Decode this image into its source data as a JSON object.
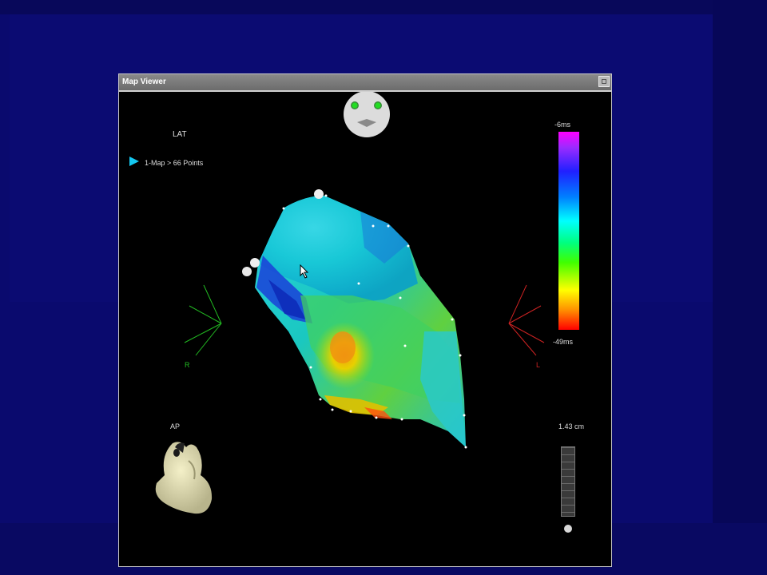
{
  "window": {
    "title": "Map Viewer"
  },
  "map": {
    "mode_label": "LAT",
    "map_entry": "1-Map > 66 Points",
    "view_label": "AP",
    "orientation_right": "R",
    "orientation_left": "L"
  },
  "colorbar": {
    "max_label": "-6ms",
    "min_label": "-49ms"
  },
  "scale": {
    "label": "1.43 cm"
  },
  "colors": {
    "background": "#0a0a6e",
    "window_title_bar": "#7a7a7a",
    "selector_arrow": "#14c8f0",
    "orientation_right": "#22bb22",
    "orientation_left": "#cc2222"
  },
  "icons": {
    "face": "face-icon",
    "heart": "heart-icon",
    "cursor": "cursor-icon",
    "selector": "play-arrow-icon"
  }
}
